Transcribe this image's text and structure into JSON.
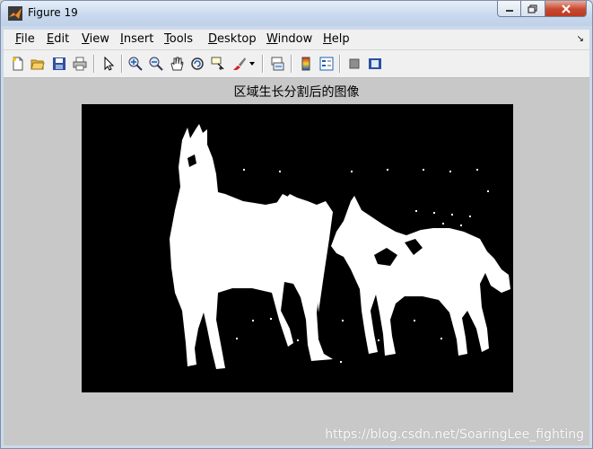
{
  "window": {
    "title": "Figure 19",
    "controls": {
      "minimize": "minimize",
      "maximize": "maximize",
      "close": "close"
    }
  },
  "menubar": {
    "items": [
      {
        "label_first": "F",
        "label_rest": "ile"
      },
      {
        "label_first": "E",
        "label_rest": "dit"
      },
      {
        "label_first": "V",
        "label_rest": "iew"
      },
      {
        "label_first": "I",
        "label_rest": "nsert"
      },
      {
        "label_first": "T",
        "label_rest": "ools"
      },
      {
        "label_first": "D",
        "label_rest": "esktop"
      },
      {
        "label_first": "W",
        "label_rest": "indow"
      },
      {
        "label_first": "H",
        "label_rest": "elp"
      }
    ],
    "dock_arrow": "↘"
  },
  "toolbar": {
    "icons": [
      "new-figure-icon",
      "open-file-icon",
      "save-icon",
      "print-icon",
      "edit-plot-arrow-icon",
      "zoom-in-icon",
      "zoom-out-icon",
      "pan-hand-icon",
      "rotate-3d-icon",
      "data-cursor-icon",
      "brush-icon",
      "link-plot-icon",
      "insert-colorbar-icon",
      "insert-legend-icon",
      "hide-plot-tools-icon",
      "show-plot-tools-icon"
    ]
  },
  "figure": {
    "title": "区域生长分割后的图像",
    "image_description_colors": {
      "background": "#000000",
      "foreground": "#ffffff"
    }
  },
  "watermark": "https://blog.csdn.net/SoaringLee_fighting"
}
